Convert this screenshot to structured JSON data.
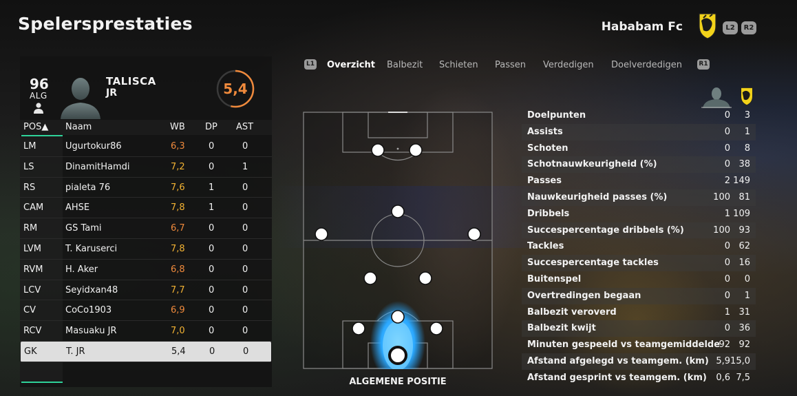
{
  "header": {
    "title": "Spelersprestaties",
    "team_name": "Hababam Fc",
    "l2": "L2",
    "r2": "R2"
  },
  "player": {
    "overall": "96",
    "overall_label": "ALG",
    "first_name": "TALISCA",
    "last_name": "JR",
    "match_rating": "5,4"
  },
  "table": {
    "headers": {
      "pos": "POS▲",
      "name": "Naam",
      "wb": "WB",
      "dp": "DP",
      "ast": "AST"
    },
    "rows": [
      {
        "pos": "LM",
        "name": "Ugurtokur86",
        "wb": "6,3",
        "dp": "0",
        "ast": "0"
      },
      {
        "pos": "LS",
        "name": "DinamitHamdi",
        "wb": "7,2",
        "dp": "0",
        "ast": "1"
      },
      {
        "pos": "RS",
        "name": "pialeta 76",
        "wb": "7,6",
        "dp": "1",
        "ast": "0"
      },
      {
        "pos": "CAM",
        "name": "AHSE",
        "wb": "7,8",
        "dp": "1",
        "ast": "0"
      },
      {
        "pos": "RM",
        "name": "GS Tami",
        "wb": "6,7",
        "dp": "0",
        "ast": "0"
      },
      {
        "pos": "LVM",
        "name": "T. Karuserci",
        "wb": "7,8",
        "dp": "0",
        "ast": "0"
      },
      {
        "pos": "RVM",
        "name": "H. Aker",
        "wb": "6,8",
        "dp": "0",
        "ast": "0"
      },
      {
        "pos": "LCV",
        "name": "Seyidxan48",
        "wb": "7,7",
        "dp": "0",
        "ast": "0"
      },
      {
        "pos": "CV",
        "name": "CoCo1903",
        "wb": "6,9",
        "dp": "0",
        "ast": "0"
      },
      {
        "pos": "RCV",
        "name": "Masuaku JR",
        "wb": "7,0",
        "dp": "0",
        "ast": "0"
      },
      {
        "pos": "GK",
        "name": "T. JR",
        "wb": "5,4",
        "dp": "0",
        "ast": "0"
      }
    ]
  },
  "tabs": {
    "l1": "L1",
    "r1": "R1",
    "items": [
      "Overzicht",
      "Balbezit",
      "Schieten",
      "Passen",
      "Verdedigen",
      "Doelverdedigen"
    ],
    "active": "Overzicht"
  },
  "pitch": {
    "caption": "ALGEMENE POSITIE"
  },
  "stats": [
    {
      "label": "Doelpunten",
      "player": "0",
      "team": "3"
    },
    {
      "label": "Assists",
      "player": "0",
      "team": "1"
    },
    {
      "label": "Schoten",
      "player": "0",
      "team": "8"
    },
    {
      "label": "Schotnauwkeurigheid (%)",
      "player": "0",
      "team": "38"
    },
    {
      "label": "Passes",
      "player": "2",
      "team": "149"
    },
    {
      "label": "Nauwkeurigheid passes (%)",
      "player": "100",
      "team": "81"
    },
    {
      "label": "Dribbels",
      "player": "1",
      "team": "109"
    },
    {
      "label": "Succespercentage dribbels (%)",
      "player": "100",
      "team": "93"
    },
    {
      "label": "Tackles",
      "player": "0",
      "team": "62"
    },
    {
      "label": "Succespercentage tackles",
      "player": "0",
      "team": "16"
    },
    {
      "label": "Buitenspel",
      "player": "0",
      "team": "0"
    },
    {
      "label": "Overtredingen begaan",
      "player": "0",
      "team": "1"
    },
    {
      "label": "Balbezit veroverd",
      "player": "1",
      "team": "31"
    },
    {
      "label": "Balbezit kwijt",
      "player": "0",
      "team": "36"
    },
    {
      "label": "Minuten gespeeld vs teamgemiddelde",
      "player": "92",
      "team": "92"
    },
    {
      "label": "Afstand afgelegd vs teamgem. (km)",
      "player": "5,9",
      "team": "15,0"
    },
    {
      "label": "Afstand gesprint vs teamgem. (km)",
      "player": "0,6",
      "team": "7,5"
    }
  ],
  "colors": {
    "accent_green": "#2fd39a",
    "rating_orange": "#f08a3c",
    "wb_gold": "#f2b233",
    "wb_orange": "#f08a3c",
    "heat_blue": "#2aa8ff"
  },
  "icons": {
    "person": "person-icon",
    "club_badge": "club-badge-icon",
    "portrait": "player-portrait-silhouette"
  }
}
